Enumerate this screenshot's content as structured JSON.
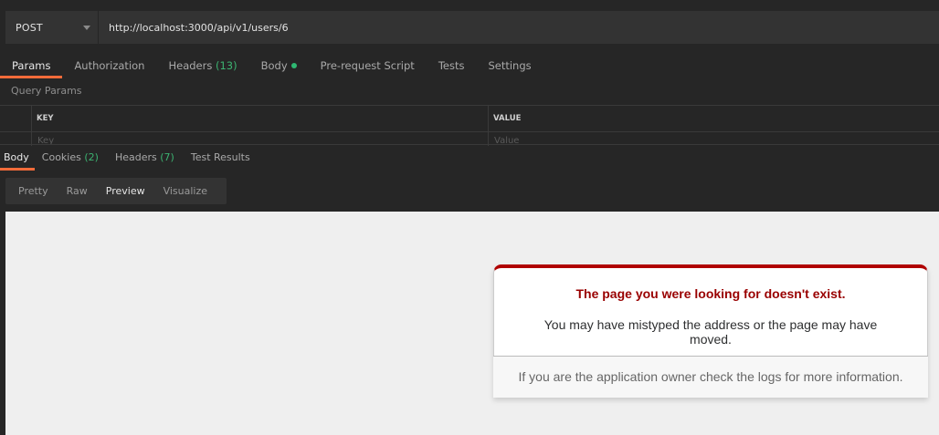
{
  "request": {
    "method": "POST",
    "url": "http://localhost:3000/api/v1/users/6"
  },
  "request_tabs": [
    {
      "label": "Params",
      "active": true
    },
    {
      "label": "Authorization"
    },
    {
      "label": "Headers",
      "count": "(13)"
    },
    {
      "label": "Body",
      "dot": true
    },
    {
      "label": "Pre-request Script"
    },
    {
      "label": "Tests"
    },
    {
      "label": "Settings"
    }
  ],
  "query_params": {
    "title": "Query Params",
    "key_header": "KEY",
    "value_header": "VALUE",
    "key_placeholder": "Key",
    "value_placeholder": "Value"
  },
  "response_tabs": [
    {
      "label": "Body",
      "active": true
    },
    {
      "label": "Cookies",
      "count": "(2)"
    },
    {
      "label": "Headers",
      "count": "(7)"
    },
    {
      "label": "Test Results"
    }
  ],
  "view_options": [
    {
      "label": "Pretty"
    },
    {
      "label": "Raw"
    },
    {
      "label": "Preview",
      "selected": true
    },
    {
      "label": "Visualize"
    }
  ],
  "error_page": {
    "title": "The page you were looking for doesn't exist.",
    "body": "You may have mistyped the address or the page may have moved.",
    "footer": "If you are the application owner check the logs for more information."
  },
  "colors": {
    "accent": "#f26b3a",
    "count_green": "#3cb371",
    "error_red": "#990000",
    "error_border": "#b00100"
  }
}
